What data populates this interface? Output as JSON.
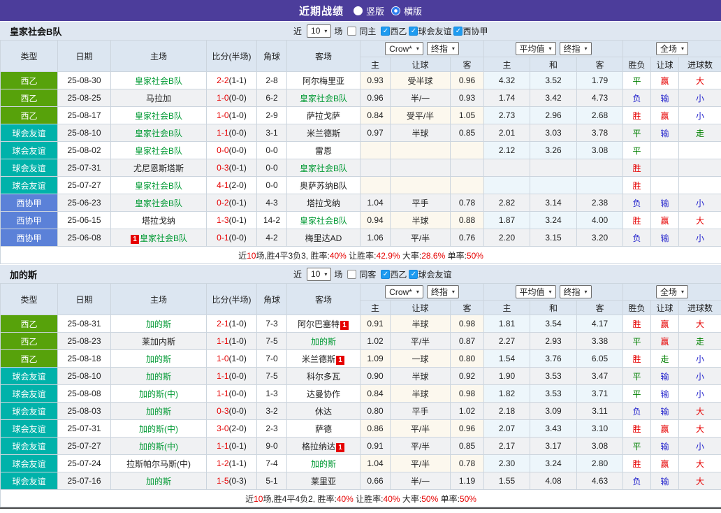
{
  "topbar": {
    "title": "近期战绩",
    "vertical_label": "竖版",
    "horizontal_label": "横版"
  },
  "filters_common": {
    "near": "近",
    "rounds": "10",
    "games": "场"
  },
  "table_header": {
    "cols": [
      "类型",
      "日期",
      "主场",
      "比分(半场)",
      "角球",
      "客场"
    ],
    "crow_select": "Crow*",
    "final_select": "终指",
    "avg_select": "平均值",
    "final_select2": "终指",
    "full_select": "全场",
    "crow_sub": [
      "主",
      "让球",
      "客"
    ],
    "avg_sub": [
      "主",
      "和",
      "客"
    ],
    "result_sub": [
      "胜负",
      "让球",
      "进球数"
    ]
  },
  "league_colors": {
    "西乙": "#57a20b",
    "球会友谊": "#00b2aa",
    "西协甲": "#5b81d8"
  },
  "result_colors": {
    "胜": "red",
    "平": "green",
    "负": "blue",
    "赢": "red",
    "输": "blue",
    "走": "green",
    "大": "red",
    "小": "blue"
  },
  "sections": [
    {
      "team": "皇家社会B队",
      "same_filter": {
        "label": "同主",
        "checked": false
      },
      "league_filters": [
        {
          "label": "西乙",
          "checked": true
        },
        {
          "label": "球会友谊",
          "checked": true
        },
        {
          "label": "西协甲",
          "checked": true
        }
      ],
      "rows": [
        {
          "league": "西乙",
          "date": "25-08-30",
          "home": "皇家社会B队",
          "home_focus": true,
          "home_badge": "",
          "score_ft": "2-2",
          "score_ht": "(1-1)",
          "corner": "2-8",
          "away": "阿尔梅里亚",
          "away_focus": false,
          "away_badge": "",
          "crow": [
            "0.93",
            "受半球",
            "0.96"
          ],
          "avg": [
            "4.32",
            "3.52",
            "1.79"
          ],
          "result": [
            "平",
            "赢",
            "大"
          ]
        },
        {
          "league": "西乙",
          "date": "25-08-25",
          "home": "马拉加",
          "home_focus": false,
          "home_badge": "",
          "score_ft": "1-0",
          "score_ht": "(0-0)",
          "corner": "6-2",
          "away": "皇家社会B队",
          "away_focus": true,
          "away_badge": "",
          "crow": [
            "0.96",
            "半/一",
            "0.93"
          ],
          "avg": [
            "1.74",
            "3.42",
            "4.73"
          ],
          "result": [
            "负",
            "输",
            "小"
          ]
        },
        {
          "league": "西乙",
          "date": "25-08-17",
          "home": "皇家社会B队",
          "home_focus": true,
          "home_badge": "",
          "score_ft": "1-0",
          "score_ht": "(1-0)",
          "corner": "2-9",
          "away": "萨拉戈萨",
          "away_focus": false,
          "away_badge": "",
          "crow": [
            "0.84",
            "受平/半",
            "1.05"
          ],
          "avg": [
            "2.73",
            "2.96",
            "2.68"
          ],
          "result": [
            "胜",
            "赢",
            "小"
          ]
        },
        {
          "league": "球会友谊",
          "date": "25-08-10",
          "home": "皇家社会B队",
          "home_focus": true,
          "home_badge": "",
          "score_ft": "1-1",
          "score_ht": "(0-0)",
          "corner": "3-1",
          "away": "米兰德斯",
          "away_focus": false,
          "away_badge": "",
          "crow": [
            "0.97",
            "半球",
            "0.85"
          ],
          "avg": [
            "2.01",
            "3.03",
            "3.78"
          ],
          "result": [
            "平",
            "输",
            "走"
          ]
        },
        {
          "league": "球会友谊",
          "date": "25-08-02",
          "home": "皇家社会B队",
          "home_focus": true,
          "home_badge": "",
          "score_ft": "0-0",
          "score_ht": "(0-0)",
          "corner": "0-0",
          "away": "雷恩",
          "away_focus": false,
          "away_badge": "",
          "crow": [
            "",
            "",
            ""
          ],
          "avg": [
            "2.12",
            "3.26",
            "3.08"
          ],
          "result": [
            "平",
            "",
            ""
          ]
        },
        {
          "league": "球会友谊",
          "date": "25-07-31",
          "home": "尤尼恩斯塔斯",
          "home_focus": false,
          "home_badge": "",
          "score_ft": "0-3",
          "score_ht": "(0-1)",
          "corner": "0-0",
          "away": "皇家社会B队",
          "away_focus": true,
          "away_badge": "",
          "crow": [
            "",
            "",
            ""
          ],
          "avg": [
            "",
            "",
            ""
          ],
          "result": [
            "胜",
            "",
            ""
          ]
        },
        {
          "league": "球会友谊",
          "date": "25-07-27",
          "home": "皇家社会B队",
          "home_focus": true,
          "home_badge": "",
          "score_ft": "4-1",
          "score_ht": "(2-0)",
          "corner": "0-0",
          "away": "奥萨苏纳B队",
          "away_focus": false,
          "away_badge": "",
          "crow": [
            "",
            "",
            ""
          ],
          "avg": [
            "",
            "",
            ""
          ],
          "result": [
            "胜",
            "",
            ""
          ]
        },
        {
          "league": "西协甲",
          "date": "25-06-23",
          "home": "皇家社会B队",
          "home_focus": true,
          "home_badge": "",
          "score_ft": "0-2",
          "score_ht": "(0-1)",
          "corner": "4-3",
          "away": "塔拉戈纳",
          "away_focus": false,
          "away_badge": "",
          "crow": [
            "1.04",
            "平手",
            "0.78"
          ],
          "avg": [
            "2.82",
            "3.14",
            "2.38"
          ],
          "result": [
            "负",
            "输",
            "小"
          ]
        },
        {
          "league": "西协甲",
          "date": "25-06-15",
          "home": "塔拉戈纳",
          "home_focus": false,
          "home_badge": "",
          "score_ft": "1-3",
          "score_ht": "(0-1)",
          "corner": "14-2",
          "away": "皇家社会B队",
          "away_focus": true,
          "away_badge": "",
          "crow": [
            "0.94",
            "半球",
            "0.88"
          ],
          "avg": [
            "1.87",
            "3.24",
            "4.00"
          ],
          "result": [
            "胜",
            "赢",
            "大"
          ]
        },
        {
          "league": "西协甲",
          "date": "25-06-08",
          "home": "皇家社会B队",
          "home_focus": true,
          "home_badge": "1",
          "score_ft": "0-1",
          "score_ht": "(0-0)",
          "corner": "4-2",
          "away": "梅里达AD",
          "away_focus": false,
          "away_badge": "",
          "crow": [
            "1.06",
            "平/半",
            "0.76"
          ],
          "avg": [
            "2.20",
            "3.15",
            "3.20"
          ],
          "result": [
            "负",
            "输",
            "小"
          ]
        }
      ],
      "summary": [
        {
          "text": "近",
          "red": false
        },
        {
          "text": "10",
          "red": true
        },
        {
          "text": "场,胜4平3负3, 胜率:",
          "red": false
        },
        {
          "text": "40%",
          "red": true
        },
        {
          "text": " 让胜率:",
          "red": false
        },
        {
          "text": "42.9%",
          "red": true
        },
        {
          "text": " 大率:",
          "red": false
        },
        {
          "text": "28.6%",
          "red": true
        },
        {
          "text": " 单率:",
          "red": false
        },
        {
          "text": "50%",
          "red": true
        }
      ]
    },
    {
      "team": "加的斯",
      "same_filter": {
        "label": "同客",
        "checked": false
      },
      "league_filters": [
        {
          "label": "西乙",
          "checked": true
        },
        {
          "label": "球会友谊",
          "checked": true
        }
      ],
      "rows": [
        {
          "league": "西乙",
          "date": "25-08-31",
          "home": "加的斯",
          "home_focus": true,
          "home_badge": "",
          "score_ft": "2-1",
          "score_ht": "(1-0)",
          "corner": "7-3",
          "away": "阿尔巴塞特",
          "away_focus": false,
          "away_badge": "1",
          "crow": [
            "0.91",
            "半球",
            "0.98"
          ],
          "avg": [
            "1.81",
            "3.54",
            "4.17"
          ],
          "result": [
            "胜",
            "赢",
            "大"
          ]
        },
        {
          "league": "西乙",
          "date": "25-08-23",
          "home": "莱加内斯",
          "home_focus": false,
          "home_badge": "",
          "score_ft": "1-1",
          "score_ht": "(1-0)",
          "corner": "7-5",
          "away": "加的斯",
          "away_focus": true,
          "away_badge": "",
          "crow": [
            "1.02",
            "平/半",
            "0.87"
          ],
          "avg": [
            "2.27",
            "2.93",
            "3.38"
          ],
          "result": [
            "平",
            "赢",
            "走"
          ]
        },
        {
          "league": "西乙",
          "date": "25-08-18",
          "home": "加的斯",
          "home_focus": true,
          "home_badge": "",
          "score_ft": "1-0",
          "score_ht": "(1-0)",
          "corner": "7-0",
          "away": "米兰德斯",
          "away_focus": false,
          "away_badge": "1",
          "crow": [
            "1.09",
            "一球",
            "0.80"
          ],
          "avg": [
            "1.54",
            "3.76",
            "6.05"
          ],
          "result": [
            "胜",
            "走",
            "小"
          ]
        },
        {
          "league": "球会友谊",
          "date": "25-08-10",
          "home": "加的斯",
          "home_focus": true,
          "home_badge": "",
          "score_ft": "1-1",
          "score_ht": "(0-0)",
          "corner": "7-5",
          "away": "科尔多瓦",
          "away_focus": false,
          "away_badge": "",
          "crow": [
            "0.90",
            "半球",
            "0.92"
          ],
          "avg": [
            "1.90",
            "3.53",
            "3.47"
          ],
          "result": [
            "平",
            "输",
            "小"
          ]
        },
        {
          "league": "球会友谊",
          "date": "25-08-08",
          "home": "加的斯(中)",
          "home_focus": true,
          "home_badge": "",
          "score_ft": "1-1",
          "score_ht": "(0-0)",
          "corner": "1-3",
          "away": "达曼协作",
          "away_focus": false,
          "away_badge": "",
          "crow": [
            "0.84",
            "半球",
            "0.98"
          ],
          "avg": [
            "1.82",
            "3.53",
            "3.71"
          ],
          "result": [
            "平",
            "输",
            "小"
          ]
        },
        {
          "league": "球会友谊",
          "date": "25-08-03",
          "home": "加的斯",
          "home_focus": true,
          "home_badge": "",
          "score_ft": "0-3",
          "score_ht": "(0-0)",
          "corner": "3-2",
          "away": "休达",
          "away_focus": false,
          "away_badge": "",
          "crow": [
            "0.80",
            "平手",
            "1.02"
          ],
          "avg": [
            "2.18",
            "3.09",
            "3.11"
          ],
          "result": [
            "负",
            "输",
            "大"
          ]
        },
        {
          "league": "球会友谊",
          "date": "25-07-31",
          "home": "加的斯(中)",
          "home_focus": true,
          "home_badge": "",
          "score_ft": "3-0",
          "score_ht": "(2-0)",
          "corner": "2-3",
          "away": "萨德",
          "away_focus": false,
          "away_badge": "",
          "crow": [
            "0.86",
            "平/半",
            "0.96"
          ],
          "avg": [
            "2.07",
            "3.43",
            "3.10"
          ],
          "result": [
            "胜",
            "赢",
            "大"
          ]
        },
        {
          "league": "球会友谊",
          "date": "25-07-27",
          "home": "加的斯(中)",
          "home_focus": true,
          "home_badge": "",
          "score_ft": "1-1",
          "score_ht": "(0-1)",
          "corner": "9-0",
          "away": "格拉纳达",
          "away_focus": false,
          "away_badge": "1",
          "crow": [
            "0.91",
            "平/半",
            "0.85"
          ],
          "avg": [
            "2.17",
            "3.17",
            "3.08"
          ],
          "result": [
            "平",
            "输",
            "小"
          ]
        },
        {
          "league": "球会友谊",
          "date": "25-07-24",
          "home": "拉斯帕尔马斯(中)",
          "home_focus": false,
          "home_badge": "",
          "score_ft": "1-2",
          "score_ht": "(1-1)",
          "corner": "7-4",
          "away": "加的斯",
          "away_focus": true,
          "away_badge": "",
          "crow": [
            "1.04",
            "平/半",
            "0.78"
          ],
          "avg": [
            "2.30",
            "3.24",
            "2.80"
          ],
          "result": [
            "胜",
            "赢",
            "大"
          ]
        },
        {
          "league": "球会友谊",
          "date": "25-07-16",
          "home": "加的斯",
          "home_focus": true,
          "home_badge": "",
          "score_ft": "1-5",
          "score_ht": "(0-3)",
          "corner": "5-1",
          "away": "莱里亚",
          "away_focus": false,
          "away_badge": "",
          "crow": [
            "0.66",
            "半/一",
            "1.19"
          ],
          "avg": [
            "1.55",
            "4.08",
            "4.63"
          ],
          "result": [
            "负",
            "输",
            "大"
          ]
        }
      ],
      "summary": [
        {
          "text": "近",
          "red": false
        },
        {
          "text": "10",
          "red": true
        },
        {
          "text": "场,胜4平4负2, 胜率:",
          "red": false
        },
        {
          "text": "40%",
          "red": true
        },
        {
          "text": " 让胜率:",
          "red": false
        },
        {
          "text": "40%",
          "red": true
        },
        {
          "text": " 大率:",
          "red": false
        },
        {
          "text": "50%",
          "red": true
        },
        {
          "text": " 单率:",
          "red": false
        },
        {
          "text": "50%",
          "red": true
        }
      ]
    }
  ]
}
